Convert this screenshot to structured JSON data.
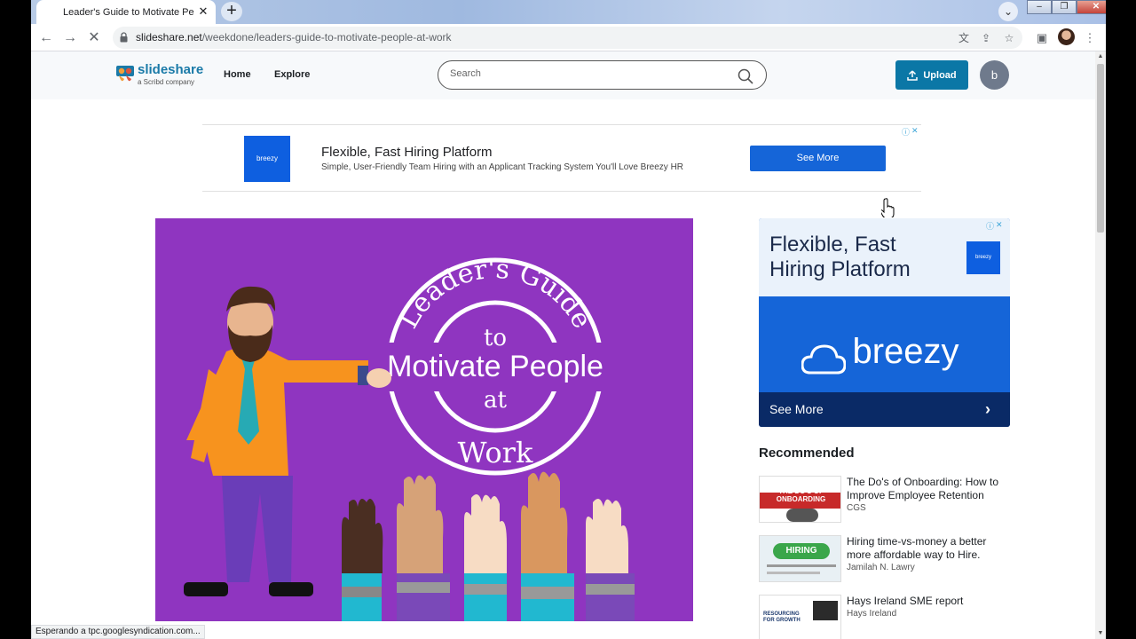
{
  "browser": {
    "tab_title": "Leader's Guide to Motivate People at Work",
    "tab_close": "✕",
    "new_tab": "+",
    "url_host": "slideshare.net",
    "url_path": "/weekdone/leaders-guide-to-motivate-people-at-work",
    "status": "Esperando a tpc.googlesyndication.com..."
  },
  "header": {
    "logo_text": "slideshare",
    "logo_sub": "a Scribd company",
    "nav": [
      "Home",
      "Explore"
    ],
    "search_placeholder": "Search",
    "upload_label": "Upload",
    "avatar_initial": "b"
  },
  "top_ad": {
    "logo": "breezy",
    "title": "Flexible, Fast Hiring Platform",
    "description": "Simple, User-Friendly Team Hiring with an Applicant Tracking System You'll Love Breezy HR",
    "cta": "See More"
  },
  "slide": {
    "ring_top": "Leader's Guide",
    "line_to": "to",
    "line_main": "Motivate People",
    "line_at": "at",
    "line_work": "Work"
  },
  "side_ad": {
    "title": "Flexible, Fast Hiring Platform",
    "logo": "breezy",
    "brand": "breezy",
    "cta": "See More"
  },
  "recommended": {
    "heading": "Recommended",
    "items": [
      {
        "title": "The Do's of Onboarding: How to Improve Employee Retention",
        "author": "CGS",
        "thumb_text": "THE DO'S OF ONBOARDING"
      },
      {
        "title": "Hiring time-vs-money a better more affordable way to Hire.",
        "author": "Jamilah N. Lawry",
        "thumb_text": "HIRING"
      },
      {
        "title": "Hays Ireland SME report",
        "author": "Hays Ireland",
        "thumb_text": "RESOURCING FOR GROWTH"
      }
    ]
  },
  "colors": {
    "slide_bg": "#8f35c0",
    "brand_blue": "#0b77a6",
    "ad_blue": "#1565d8"
  }
}
